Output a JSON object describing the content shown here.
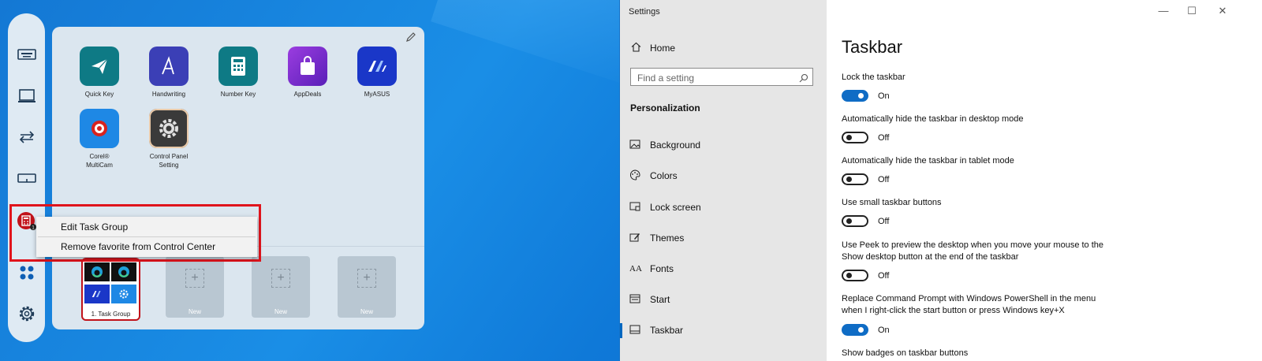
{
  "control_center": {
    "apps": [
      {
        "label": "Quick Key",
        "icon": "paper-plane-icon",
        "color": "#0e7a85"
      },
      {
        "label": "Handwriting",
        "icon": "handwriting-a-icon",
        "color": "#3b3fb6"
      },
      {
        "label": "Number Key",
        "icon": "keypad-icon",
        "color": "#0e7a85"
      },
      {
        "label": "AppDeals",
        "icon": "shopping-bag-icon",
        "color": "#7a2bd6"
      },
      {
        "label": "MyASUS",
        "icon": "myasus-logo-icon",
        "color": "#1a37c8"
      },
      {
        "label": "Corel®\nMultiCam",
        "icon": "multicam-icon",
        "color": "#1e88e5"
      },
      {
        "label": "Control Panel\nSetting",
        "icon": "gear-icon",
        "color": "#3a3a3a"
      }
    ],
    "task_group": {
      "label": "1. Task Group"
    },
    "new_slots": [
      "New",
      "New",
      "New"
    ],
    "context_menu": {
      "items": [
        "Edit Task Group",
        "Remove favorite from Control Center"
      ]
    },
    "colors": {
      "highlight": "#e0141c",
      "badge": "#c1121a"
    }
  },
  "settings": {
    "window_title": "Settings",
    "caption": {
      "minimize": "—",
      "maximize": "☐",
      "close": "✕"
    },
    "home_label": "Home",
    "search_placeholder": "Find a setting",
    "section": "Personalization",
    "nav": [
      {
        "label": "Background",
        "icon": "picture-icon"
      },
      {
        "label": "Colors",
        "icon": "palette-icon"
      },
      {
        "label": "Lock screen",
        "icon": "lock-screen-icon"
      },
      {
        "label": "Themes",
        "icon": "brush-icon"
      },
      {
        "label": "Fonts",
        "icon": "font-icon"
      },
      {
        "label": "Start",
        "icon": "start-icon"
      },
      {
        "label": "Taskbar",
        "icon": "taskbar-icon"
      }
    ],
    "active_nav": "Taskbar",
    "page_title": "Taskbar",
    "options": [
      {
        "label": "Lock the taskbar",
        "state": "On"
      },
      {
        "label": "Automatically hide the taskbar in desktop mode",
        "state": "Off"
      },
      {
        "label": "Automatically hide the taskbar in tablet mode",
        "state": "Off"
      },
      {
        "label": "Use small taskbar buttons",
        "state": "Off"
      },
      {
        "label": "Use Peek to preview the desktop when you move your mouse to the\nShow desktop button at the end of the taskbar",
        "state": "Off"
      },
      {
        "label": "Replace Command Prompt with Windows PowerShell in the menu\nwhen I right-click the start button or press Windows key+X",
        "state": "On"
      }
    ],
    "partial_option": "Show badges on taskbar buttons",
    "accent": "#0f6cc5"
  }
}
